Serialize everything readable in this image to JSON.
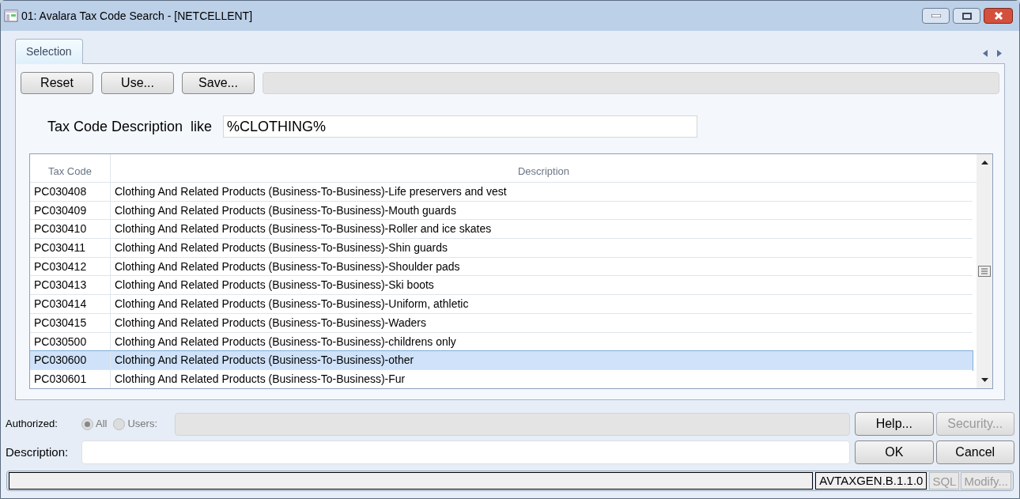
{
  "window": {
    "title": "01:  Avalara Tax Code Search - [NETCELLENT]"
  },
  "tabs": [
    {
      "label": "Selection",
      "selected": true
    }
  ],
  "toolbar": {
    "buttons": [
      "Reset",
      "Use...",
      "Save..."
    ]
  },
  "filter": {
    "label": "Tax Code Description  like",
    "value": "%CLOTHING%"
  },
  "table": {
    "columns": [
      "Tax Code",
      "Description"
    ],
    "rows": [
      {
        "code": "PC030408",
        "description": "Clothing And Related Products (Business-To-Business)-Life preservers and vest",
        "selected": false
      },
      {
        "code": "PC030409",
        "description": "Clothing And Related Products (Business-To-Business)-Mouth guards",
        "selected": false
      },
      {
        "code": "PC030410",
        "description": "Clothing And Related Products (Business-To-Business)-Roller and ice skates",
        "selected": false
      },
      {
        "code": "PC030411",
        "description": "Clothing And Related Products (Business-To-Business)-Shin guards",
        "selected": false
      },
      {
        "code": "PC030412",
        "description": "Clothing And Related Products (Business-To-Business)-Shoulder pads",
        "selected": false
      },
      {
        "code": "PC030413",
        "description": "Clothing And Related Products (Business-To-Business)-Ski boots",
        "selected": false
      },
      {
        "code": "PC030414",
        "description": "Clothing And Related Products (Business-To-Business)-Uniform, athletic",
        "selected": false
      },
      {
        "code": "PC030415",
        "description": "Clothing And Related Products (Business-To-Business)-Waders",
        "selected": false
      },
      {
        "code": "PC030500",
        "description": "Clothing And Related Products (Business-To-Business)-childrens only",
        "selected": false
      },
      {
        "code": "PC030600",
        "description": "Clothing And Related Products (Business-To-Business)-other",
        "selected": true
      },
      {
        "code": "PC030601",
        "description": "Clothing And Related Products (Business-To-Business)-Fur",
        "selected": false
      }
    ]
  },
  "authorized": {
    "label": "Authorized:",
    "options": [
      {
        "label": "All",
        "selected": true
      },
      {
        "label": "Users:",
        "selected": false
      }
    ]
  },
  "description": {
    "label": "Description:"
  },
  "side_buttons": [
    {
      "label": "Help...",
      "disabled": false
    },
    {
      "label": "Security...",
      "disabled": true
    },
    {
      "label": "OK",
      "disabled": false
    },
    {
      "label": "Cancel",
      "disabled": false
    }
  ],
  "status_bar": {
    "version": "AVTAXGEN.B.1.1.0",
    "buttons": [
      {
        "label": "SQL",
        "disabled": true
      },
      {
        "label": "Modify...",
        "disabled": true
      }
    ]
  }
}
